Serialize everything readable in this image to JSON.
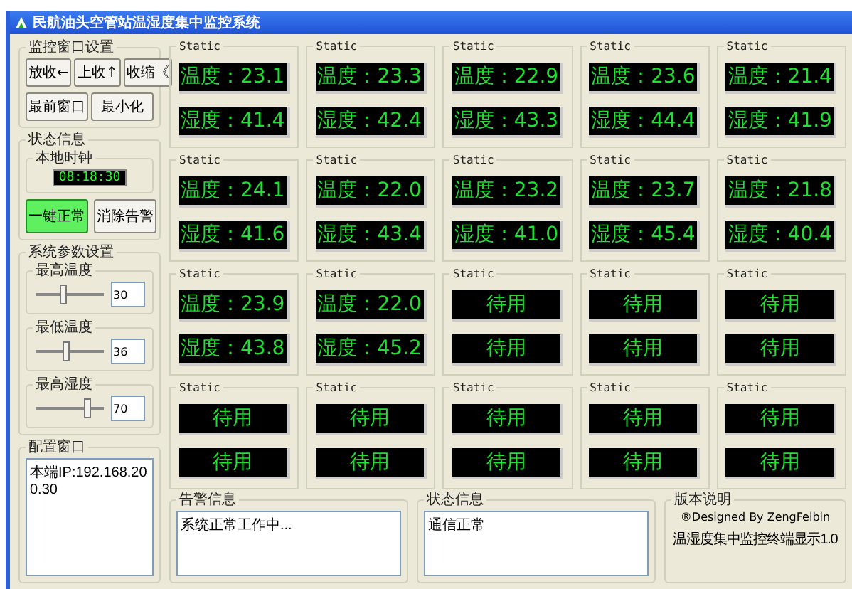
{
  "window": {
    "title": "民航油头空管站温湿度集中监控系统"
  },
  "window_settings": {
    "title": "监控窗口设置",
    "buttons": [
      "放收←",
      "上收↑",
      "收缩《",
      "最前窗口",
      "最小化"
    ]
  },
  "status": {
    "title": "状态信息",
    "clock_label": "本地时钟",
    "clock": "08:18:30",
    "buttons": [
      {
        "label": "一键正常",
        "kind": "green"
      },
      {
        "label": "消除告警",
        "kind": "normal"
      }
    ]
  },
  "parameters": {
    "title": "系统参数设置",
    "items": [
      {
        "label": "最高温度",
        "level": 0.4,
        "value": "30"
      },
      {
        "label": "最低温度",
        "level": 0.45,
        "value": "36"
      },
      {
        "label": "最高湿度",
        "level": 0.75,
        "value": "70"
      }
    ]
  },
  "config": {
    "title": "配置窗口",
    "text": "本端IP:192.168.200.30"
  },
  "panels": [
    {
      "title": "Static",
      "lines": [
        "温度：23.1",
        "湿度：41.4"
      ]
    },
    {
      "title": "Static",
      "lines": [
        "温度：23.3",
        "湿度：42.4"
      ]
    },
    {
      "title": "Static",
      "lines": [
        "温度：22.9",
        "湿度：43.3"
      ]
    },
    {
      "title": "Static",
      "lines": [
        "温度：23.6",
        "湿度：44.4"
      ]
    },
    {
      "title": "Static",
      "lines": [
        "温度：21.4",
        "湿度：41.9"
      ]
    },
    {
      "title": "Static",
      "lines": [
        "温度：24.1",
        "湿度：41.6"
      ]
    },
    {
      "title": "Static",
      "lines": [
        "温度：22.0",
        "湿度：43.4"
      ]
    },
    {
      "title": "Static",
      "lines": [
        "温度：23.2",
        "湿度：41.0"
      ]
    },
    {
      "title": "Static",
      "lines": [
        "温度：23.7",
        "湿度：45.4"
      ]
    },
    {
      "title": "Static",
      "lines": [
        "温度：21.8",
        "湿度：40.4"
      ]
    },
    {
      "title": "Static",
      "lines": [
        "温度：23.9",
        "湿度：43.8"
      ]
    },
    {
      "title": "Static",
      "lines": [
        "温度：22.0",
        "湿度：45.2"
      ]
    },
    {
      "title": "Static",
      "lines": [
        "待用",
        "待用"
      ]
    },
    {
      "title": "Static",
      "lines": [
        "待用",
        "待用"
      ]
    },
    {
      "title": "Static",
      "lines": [
        "待用",
        "待用"
      ]
    },
    {
      "title": "Static",
      "lines": [
        "待用",
        "待用"
      ]
    },
    {
      "title": "Static",
      "lines": [
        "待用",
        "待用"
      ]
    },
    {
      "title": "Static",
      "lines": [
        "待用",
        "待用"
      ]
    },
    {
      "title": "Static",
      "lines": [
        "待用",
        "待用"
      ]
    },
    {
      "title": "Static",
      "lines": [
        "待用",
        "待用"
      ]
    }
  ],
  "alarm": {
    "title": "告警信息",
    "text": "系统正常工作中..."
  },
  "state": {
    "title": "状态信息",
    "text": "通信正常"
  },
  "version": {
    "title": "版本说明",
    "lines": [
      "®Designed By ZengFeibin",
      "温湿度集中监控终端显示1.0"
    ]
  }
}
